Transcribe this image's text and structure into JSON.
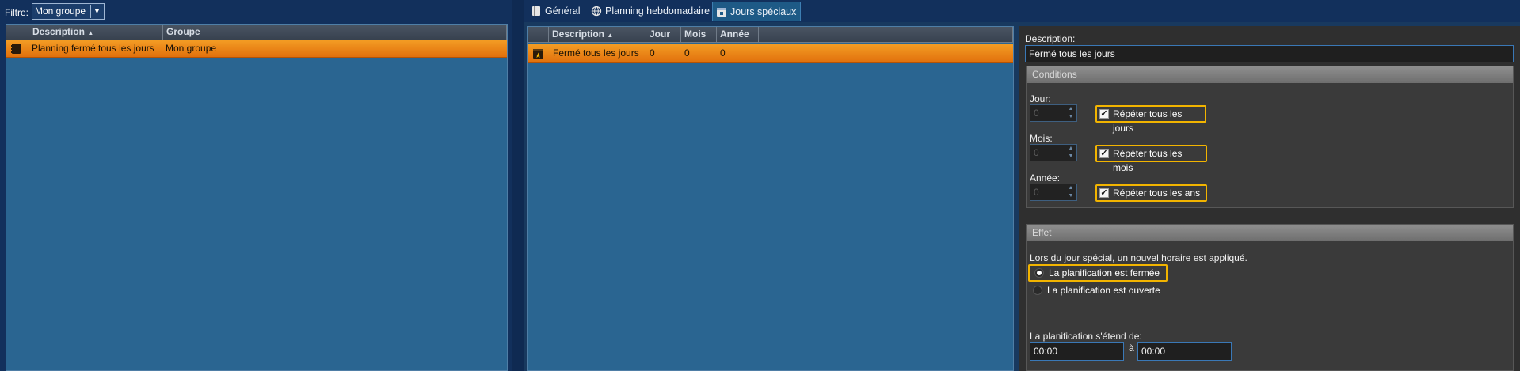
{
  "filter": {
    "label": "Filtre:",
    "value": "Mon groupe"
  },
  "left_grid": {
    "headers": [
      "Description",
      "Groupe"
    ],
    "rows": [
      {
        "description": "Planning fermé tous les jours",
        "groupe": "Mon groupe"
      }
    ]
  },
  "tabs": [
    {
      "label": "Général",
      "icon": "book-icon"
    },
    {
      "label": "Planning hebdomadaire",
      "icon": "globe-icon"
    },
    {
      "label": "Jours spéciaux",
      "icon": "calendar-icon",
      "active": true
    }
  ],
  "right_grid": {
    "headers": [
      "Description",
      "Jour",
      "Mois",
      "Année"
    ],
    "rows": [
      {
        "description": "Fermé tous les jours",
        "jour": "0",
        "mois": "0",
        "annee": "0"
      }
    ]
  },
  "details": {
    "description_label": "Description:",
    "description_value": "Fermé tous les jours",
    "conditions": {
      "title": "Conditions",
      "jour_label": "Jour:",
      "jour_value": "0",
      "jour_repeat": "Répéter tous les jours",
      "mois_label": "Mois:",
      "mois_value": "0",
      "mois_repeat": "Répéter tous les mois",
      "annee_label": "Année:",
      "annee_value": "0",
      "annee_repeat": "Répéter tous les ans"
    },
    "effet": {
      "title": "Effet",
      "info": "Lors du jour spécial, un nouvel horaire est appliqué.",
      "option_closed": "La planification est fermée",
      "option_open": "La planification est ouverte",
      "range_label": "La planification s'étend de:",
      "from": "00:00",
      "to_label": "à",
      "to": "00:00"
    }
  },
  "colors": {
    "accent": "#f2b400",
    "row_selected": "#f08a1c",
    "grid_bg": "#2a6591"
  }
}
